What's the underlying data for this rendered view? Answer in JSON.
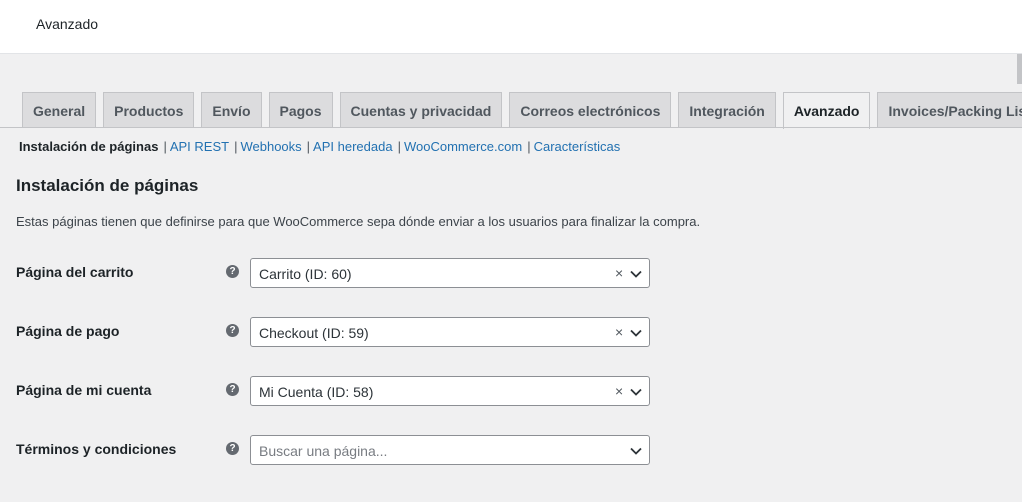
{
  "header": {
    "title": "Avanzado"
  },
  "tabs": [
    {
      "label": "General"
    },
    {
      "label": "Productos"
    },
    {
      "label": "Envío"
    },
    {
      "label": "Pagos"
    },
    {
      "label": "Cuentas y privacidad"
    },
    {
      "label": "Correos electrónicos"
    },
    {
      "label": "Integración"
    },
    {
      "label": "Avanzado"
    },
    {
      "label": "Invoices/Packing Lists"
    }
  ],
  "active_tab": "Avanzado",
  "subnav": [
    {
      "label": "Instalación de páginas"
    },
    {
      "label": "API REST"
    },
    {
      "label": "Webhooks"
    },
    {
      "label": "API heredada"
    },
    {
      "label": "WooCommerce.com"
    },
    {
      "label": "Características"
    }
  ],
  "subnav_separator": "|",
  "section": {
    "title": "Instalación de páginas",
    "description": "Estas páginas tienen que definirse para que WooCommerce sepa dónde enviar a los usuarios para finalizar la compra."
  },
  "fields": [
    {
      "label": "Página del carrito",
      "value": "Carrito (ID: 60)"
    },
    {
      "label": "Página de pago",
      "value": "Checkout (ID: 59)"
    },
    {
      "label": "Página de mi cuenta",
      "value": "Mi Cuenta (ID: 58)"
    },
    {
      "label": "Términos y condiciones",
      "placeholder": "Buscar una página..."
    }
  ],
  "icons": {
    "help": "?",
    "clear": "×"
  }
}
